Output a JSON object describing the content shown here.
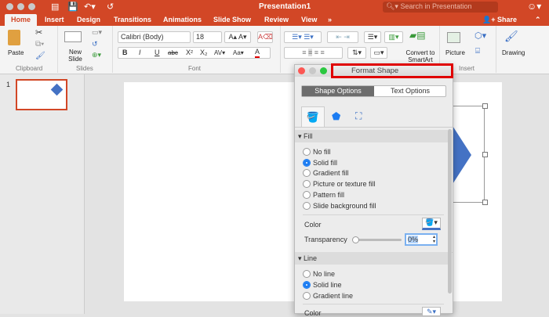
{
  "window": {
    "title": "Presentation1",
    "search_placeholder": "Search in Presentation"
  },
  "tabs": [
    "Home",
    "Insert",
    "Design",
    "Transitions",
    "Animations",
    "Slide Show",
    "Review",
    "View"
  ],
  "share_label": "Share",
  "ribbon": {
    "clipboard": {
      "label": "Clipboard",
      "paste": "Paste"
    },
    "slides": {
      "label": "Slides",
      "new_slide": "New Slide"
    },
    "font": {
      "label": "Font",
      "font_name": "Calibri (Body)",
      "font_size": "18",
      "bold": "B",
      "italic": "I",
      "underline": "U",
      "strike": "abc",
      "superscript": "X²",
      "subscript": "X₂",
      "font_color": "A"
    },
    "paragraph": {
      "convert": "Convert to SmartArt"
    },
    "insert": {
      "label": "Insert",
      "picture": "Picture"
    },
    "drawing": {
      "label": "Drawing"
    }
  },
  "thumbnail": {
    "number": "1"
  },
  "format_shape": {
    "title": "Format Shape",
    "tabs": [
      "Shape Options",
      "Text Options"
    ],
    "fill": {
      "header": "Fill",
      "options": [
        "No fill",
        "Solid fill",
        "Gradient fill",
        "Picture or texture fill",
        "Pattern fill",
        "Slide background fill"
      ],
      "selected": "Solid fill",
      "color_label": "Color",
      "transparency_label": "Transparency",
      "transparency_value": "0%",
      "transparency_fraction": 0
    },
    "line": {
      "header": "Line",
      "options": [
        "No line",
        "Solid line",
        "Gradient line"
      ],
      "selected": "Solid line",
      "color_label": "Color"
    }
  },
  "colors": {
    "accent": "#d24726",
    "shape": "#4472c4",
    "highlight": "#e00000"
  }
}
